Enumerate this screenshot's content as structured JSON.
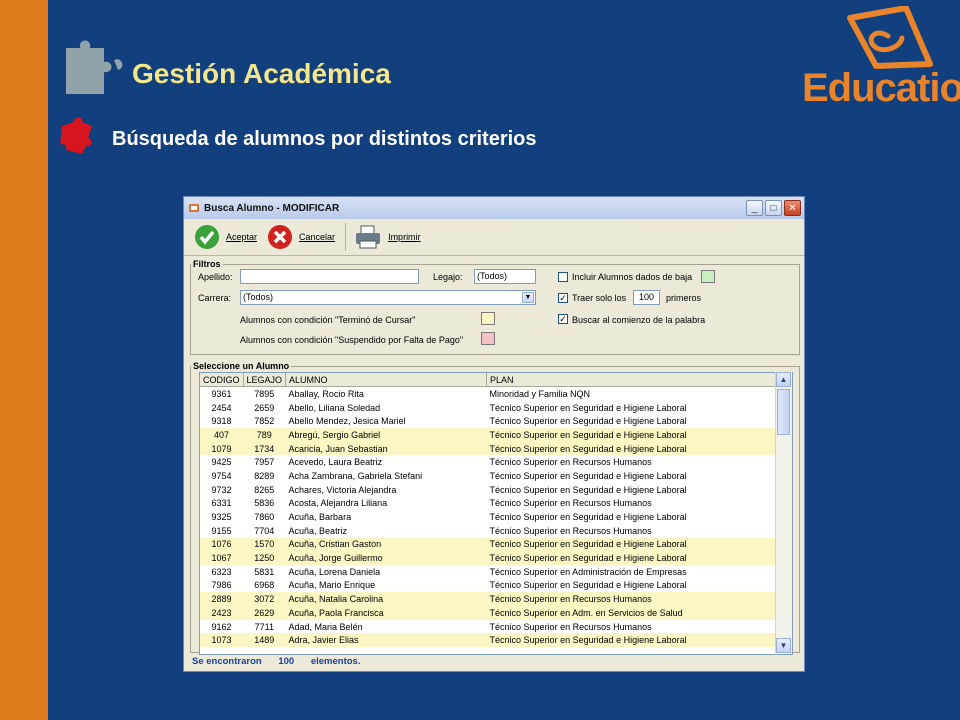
{
  "slide": {
    "title": "Gestión Académica",
    "subtitle": "Búsqueda de alumnos por distintos criterios",
    "logo_text": "Educatio",
    "logo_mark": "®",
    "colors": {
      "background": "#123f7d",
      "side_bar": "#e07a1e",
      "title": "#f4e68a",
      "logo": "#e9842a"
    },
    "icons": [
      "puzzle-piece-grey-icon",
      "puzzle-piece-red-icon",
      "educatio-logo-icon"
    ]
  },
  "window": {
    "title": "Busca Alumno - MODIFICAR",
    "controls": {
      "minimize": "_",
      "maximize": "□",
      "close": "✕"
    },
    "toolbar": {
      "accept": "Aceptar",
      "cancel": "Cancelar",
      "print": "Imprimir"
    },
    "filters": {
      "legend": "Filtros",
      "apellido_label": "Apellido:",
      "apellido_value": "",
      "legajo_label": "Legajo:",
      "legajo_value": "(Todos)",
      "carrera_label": "Carrera:",
      "carrera_value": "(Todos)",
      "terminado_label": "Alumnos con condición \"Terminó de Cursar\"",
      "suspendido_label": "Alumnos con condición \"Suspendido por Falta de Pago\"",
      "incluir_baja_label": "Incluir Alumnos dados de baja",
      "incluir_baja_checked": false,
      "traer_label": "Traer solo los",
      "traer_value": "100",
      "traer_suffix": "primeros",
      "traer_checked": true,
      "comienzo_label": "Buscar al comienzo de la palabra",
      "comienzo_checked": true,
      "swatch_colors": {
        "baja": "#c8f0c0",
        "terminado": "#fbf6c4",
        "suspendido": "#f3c2c2"
      }
    },
    "results": {
      "legend": "Seleccione un Alumno",
      "columns": [
        "CODIGO",
        "LEGAJO",
        "ALUMNO",
        "PLAN"
      ],
      "rows": [
        {
          "codigo": "9361",
          "legajo": "7895",
          "alumno": "Aballay, Rocio Rita",
          "plan": "Minoridad y Familia NQN",
          "hl": false
        },
        {
          "codigo": "2454",
          "legajo": "2659",
          "alumno": "Abello, Liliana Soledad",
          "plan": "Técnico Superior en Seguridad e Higiene Laboral",
          "hl": false
        },
        {
          "codigo": "9318",
          "legajo": "7852",
          "alumno": "Abello Mendez, Jesica Mariel",
          "plan": "Técnico Superior en Seguridad e Higiene Laboral",
          "hl": false
        },
        {
          "codigo": "407",
          "legajo": "789",
          "alumno": "Abregú, Sergio Gabriel",
          "plan": "Técnico Superior en Seguridad e Higiene Laboral",
          "hl": true
        },
        {
          "codigo": "1079",
          "legajo": "1734",
          "alumno": "Acaricia, Juan Sebastian",
          "plan": "Técnico Superior en Seguridad e Higiene Laboral",
          "hl": true
        },
        {
          "codigo": "9425",
          "legajo": "7957",
          "alumno": "Acevedo, Laura Beatriz",
          "plan": "Técnico Superior en Recursos Humanos",
          "hl": false
        },
        {
          "codigo": "9754",
          "legajo": "8289",
          "alumno": "Acha Zambrana, Gabriela Stefani",
          "plan": "Técnico Superior en Seguridad e Higiene Laboral",
          "hl": false
        },
        {
          "codigo": "9732",
          "legajo": "8265",
          "alumno": "Achares, Victoria Alejandra",
          "plan": "Técnico Superior en Seguridad e Higiene Laboral",
          "hl": false
        },
        {
          "codigo": "6331",
          "legajo": "5836",
          "alumno": "Acosta, Alejandra Liliana",
          "plan": "Técnico Superior en Recursos Humanos",
          "hl": false
        },
        {
          "codigo": "9325",
          "legajo": "7860",
          "alumno": "Acuña, Barbara",
          "plan": "Técnico Superior en Seguridad e Higiene Laboral",
          "hl": false
        },
        {
          "codigo": "9155",
          "legajo": "7704",
          "alumno": "Acuña, Beatriz",
          "plan": "Técnico Superior en Recursos Humanos",
          "hl": false
        },
        {
          "codigo": "1076",
          "legajo": "1570",
          "alumno": "Acuña, Cristian Gaston",
          "plan": "Técnico Superior en Seguridad e Higiene Laboral",
          "hl": true
        },
        {
          "codigo": "1067",
          "legajo": "1250",
          "alumno": "Acuña, Jorge Guillermo",
          "plan": "Técnico Superior en Seguridad e Higiene Laboral",
          "hl": true
        },
        {
          "codigo": "6323",
          "legajo": "5831",
          "alumno": "Acuña, Lorena Daniela",
          "plan": "Técnico Superior en Administración de Empresas",
          "hl": false
        },
        {
          "codigo": "7986",
          "legajo": "6968",
          "alumno": "Acuña, Mario Enrique",
          "plan": "Técnico Superior en Seguridad e Higiene Laboral",
          "hl": false
        },
        {
          "codigo": "2889",
          "legajo": "3072",
          "alumno": "Acuña, Natalia Carolina",
          "plan": "Técnico Superior en Recursos Humanos",
          "hl": true
        },
        {
          "codigo": "2423",
          "legajo": "2629",
          "alumno": "Acuña, Paola  Francisca",
          "plan": "Técnico Superior en Adm. en Servicios de Salud",
          "hl": true
        },
        {
          "codigo": "9162",
          "legajo": "7711",
          "alumno": "Adad, Maria Belén",
          "plan": "Técnico Superior en Recursos Humanos",
          "hl": false
        },
        {
          "codigo": "1073",
          "legajo": "1489",
          "alumno": "Adra, Javier Elias",
          "plan": "Técnico Superior en Seguridad e Higiene Laboral",
          "hl": true
        }
      ]
    },
    "status": {
      "prefix": "Se encontraron",
      "count": "100",
      "suffix": "elementos."
    }
  }
}
